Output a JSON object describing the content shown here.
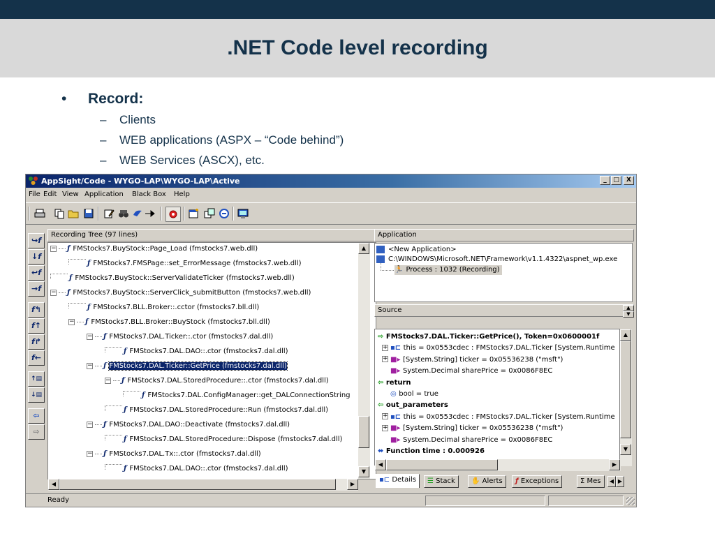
{
  "slide": {
    "title": ".NET Code level recording",
    "bullet": "Record:",
    "bullet_marker": "•",
    "subitems": [
      "Clients",
      "WEB applications (ASPX – “Code behind”)",
      "WEB Services (ASCX), etc."
    ],
    "dash": "–"
  },
  "window": {
    "title": "AppSight/Code - WYGO-LAP\\WYGO-LAP\\Active",
    "controls": [
      "_",
      "□",
      "X"
    ]
  },
  "menu": [
    "File",
    "Edit",
    "View",
    "Application",
    "Black Box",
    "Help"
  ],
  "toolbar_icons": [
    "print-icon",
    "copy-icon",
    "open-folder-icon",
    "save-icon",
    "edit-icon",
    "binoculars-icon",
    "bird-icon",
    "pin-icon",
    "record-icon",
    "new-window-icon",
    "windows-icon",
    "globe-icon",
    "monitor-icon"
  ],
  "left_toolbar": [
    "↪f",
    "↓f",
    "↩f",
    "→f",
    "f↰",
    "f↑",
    "f↱",
    "f←",
    "↑▤",
    "↓▤",
    "⇦",
    "⇨"
  ],
  "recording_tree": {
    "header": "Recording Tree (97 lines)",
    "rows": [
      {
        "level": 0,
        "expander": "−",
        "text": "FMStocks7.BuyStock::Page_Load  (fmstocks7.web.dll)"
      },
      {
        "level": 1,
        "expander": "",
        "text": "FMStocks7.FMSPage::set_ErrorMessage  (fmstocks7.web.dll)"
      },
      {
        "level": 0,
        "expander": "",
        "text": "FMStocks7.BuyStock::ServerValidateTicker  (fmstocks7.web.dll)"
      },
      {
        "level": 0,
        "expander": "−",
        "text": "FMStocks7.BuyStock::ServerClick_submitButton  (fmstocks7.web.dll)"
      },
      {
        "level": 1,
        "expander": "",
        "text": "FMStocks7.BLL.Broker::.cctor  (fmstocks7.bll.dll)"
      },
      {
        "level": 1,
        "expander": "−",
        "text": "FMStocks7.BLL.Broker::BuyStock  (fmstocks7.bll.dll)"
      },
      {
        "level": 2,
        "expander": "−",
        "text": "FMStocks7.DAL.Ticker::.ctor  (fmstocks7.dal.dll)"
      },
      {
        "level": 3,
        "expander": "",
        "text": "FMStocks7.DAL.DAO::.ctor  (fmstocks7.dal.dll)"
      },
      {
        "level": 2,
        "expander": "−",
        "text": "FMStocks7.DAL.Ticker::GetPrice  (fmstocks7.dal.dll)",
        "selected": true
      },
      {
        "level": 3,
        "expander": "−",
        "text": "FMStocks7.DAL.StoredProcedure::.ctor  (fmstocks7.dal.dll)"
      },
      {
        "level": 4,
        "expander": "",
        "text": "FMStocks7.DAL.ConfigManager::get_DALConnectionString"
      },
      {
        "level": 3,
        "expander": "",
        "text": "FMStocks7.DAL.StoredProcedure::Run  (fmstocks7.dal.dll)"
      },
      {
        "level": 2,
        "expander": "−",
        "text": "FMStocks7.DAL.DAO::Deactivate  (fmstocks7.dal.dll)"
      },
      {
        "level": 3,
        "expander": "",
        "text": "FMStocks7.DAL.StoredProcedure::Dispose  (fmstocks7.dal.dll)"
      },
      {
        "level": 2,
        "expander": "−",
        "text": "FMStocks7.DAL.Tx::.ctor  (fmstocks7.dal.dll)"
      },
      {
        "level": 3,
        "expander": "",
        "text": "FMStocks7.DAL.DAO::.ctor  (fmstocks7.dal.dll)"
      }
    ]
  },
  "application": {
    "header": "Application",
    "rows": [
      "<New Application>",
      "C:\\WINDOWS\\Microsoft.NET\\Framework\\v1.1.4322\\aspnet_wp.exe",
      "Process : 1032 (Recording)"
    ]
  },
  "source": {
    "header": "Source",
    "rows": [
      {
        "text": "FMStocks7.DAL.Ticker::GetPrice(), Token=0x0600001f",
        "bold": true,
        "icon": "arrow-right-icon"
      },
      {
        "text": "this = 0x0553cdec : FMStocks7.DAL.Ticker [System.Runtime",
        "expander": "+",
        "icon": "object-icon"
      },
      {
        "text": "[System.String] ticker = 0x05536238  (\"msft\")",
        "expander": "+",
        "icon": "parameter-icon"
      },
      {
        "text": "System.Decimal sharePrice = 0x0086F8EC",
        "icon": "parameter-icon"
      },
      {
        "text": "return",
        "bold": true,
        "icon": "arrow-left-icon"
      },
      {
        "text": "bool = true",
        "icon": "value-icon"
      },
      {
        "text": "out_parameters",
        "bold": true,
        "icon": "arrow-left-icon"
      },
      {
        "text": "this = 0x0553cdec : FMStocks7.DAL.Ticker [System.Runtime",
        "expander": "+",
        "icon": "object-icon"
      },
      {
        "text": "[System.String] ticker = 0x05536238  (\"msft\")",
        "expander": "+",
        "icon": "parameter-icon"
      },
      {
        "text": "System.Decimal sharePrice = 0x0086F8EC",
        "icon": "parameter-icon"
      },
      {
        "text": "Function time : 0.000926",
        "bold": true,
        "icon": "double-arrow-icon"
      }
    ]
  },
  "tabs": [
    "Details",
    "Stack",
    "Alerts",
    "Exceptions",
    "Mes"
  ],
  "status": {
    "text": "Ready"
  },
  "colors": {
    "title_blue": "#14324a",
    "selection": "#0a246a",
    "titlebar": "#0a246a",
    "green_arrow": "#1a9a1a"
  }
}
